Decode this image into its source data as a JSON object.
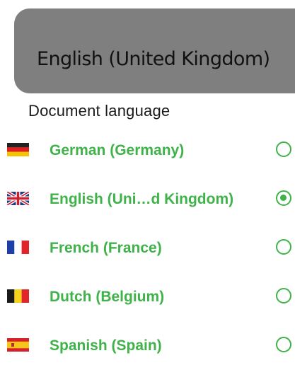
{
  "header": {
    "current_language": "English (United Kingdom)"
  },
  "section_title": "Document language",
  "colors": {
    "accent": "#3fb24a",
    "banner_bg": "#7f7f7f"
  },
  "languages": [
    {
      "label": "German (Germany)",
      "flag": "germany-flag-icon",
      "selected": false
    },
    {
      "label": "English (Uni…d Kingdom)",
      "flag": "uk-flag-icon",
      "selected": true
    },
    {
      "label": "French (France)",
      "flag": "france-flag-icon",
      "selected": false
    },
    {
      "label": "Dutch (Belgium)",
      "flag": "belgium-flag-icon",
      "selected": false
    },
    {
      "label": "Spanish (Spain)",
      "flag": "spain-flag-icon",
      "selected": false
    }
  ]
}
